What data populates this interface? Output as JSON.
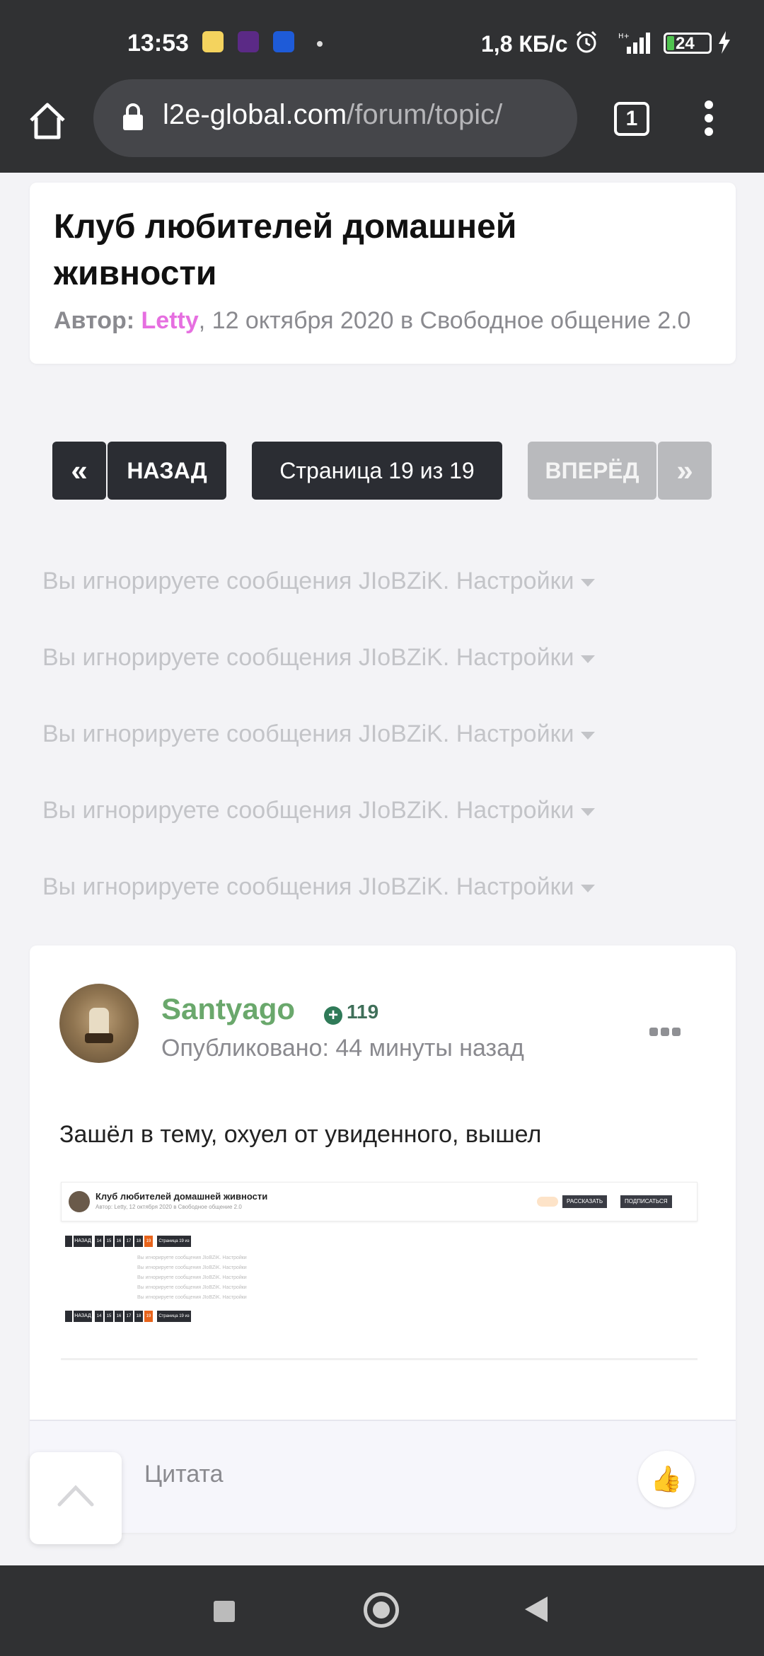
{
  "status_bar": {
    "time": "13:53",
    "net_speed": "1,8 КБ/с",
    "battery": "24",
    "notification_icons": [
      "app-icon",
      "app-icon",
      "ozon-icon"
    ],
    "icons": [
      "alarm-icon",
      "signal-icon",
      "battery-icon",
      "charging-icon"
    ]
  },
  "browser": {
    "url_host": "l2e-global.com",
    "url_path": "/forum/topic/",
    "tab_count": "1"
  },
  "topic": {
    "title": "Клуб любителей домашней живности",
    "meta_label": "Автор:",
    "author": "Letty",
    "meta_rest": ", 12 октября 2020 в Свободное общение 2.0",
    "author_color": "#e66fe0"
  },
  "pagination": {
    "first": "«",
    "back": "НАЗАД",
    "page": "Страница 19 из 19",
    "next": "ВПЕРЁД",
    "last": "»"
  },
  "ignored_messages": [
    "Вы игнорируете сообщения JIoBZiK. Настройки",
    "Вы игнорируете сообщения JIoBZiK. Настройки",
    "Вы игнорируете сообщения JIoBZiK. Настройки",
    "Вы игнорируете сообщения JIoBZiK. Настройки",
    "Вы игнорируете сообщения JIoBZiK. Настройки"
  ],
  "post": {
    "author": "Santyago",
    "author_color": "#6aa86c",
    "reputation": "119",
    "published": "Опубликовано: 44 минуты назад",
    "text": "Зашёл в тему, охуел от увиденного, вышел",
    "quote_label": "Цитата",
    "like_icon": "thumbs-up-icon",
    "attachment": {
      "title": "Клуб любителей домашней живности",
      "meta": "Автор: Letty, 12 октября 2020 в Свободное общение 2.0",
      "share": "РАССКАЗАТЬ",
      "follow": "ПОДПИСАТЬСЯ",
      "back": "НАЗАД",
      "page": "Страница 19 из 19",
      "pages": [
        "14",
        "15",
        "16",
        "17",
        "18",
        "19"
      ],
      "ignored": "Вы игнорируете сообщения JIoBZiK. Настройки"
    }
  }
}
